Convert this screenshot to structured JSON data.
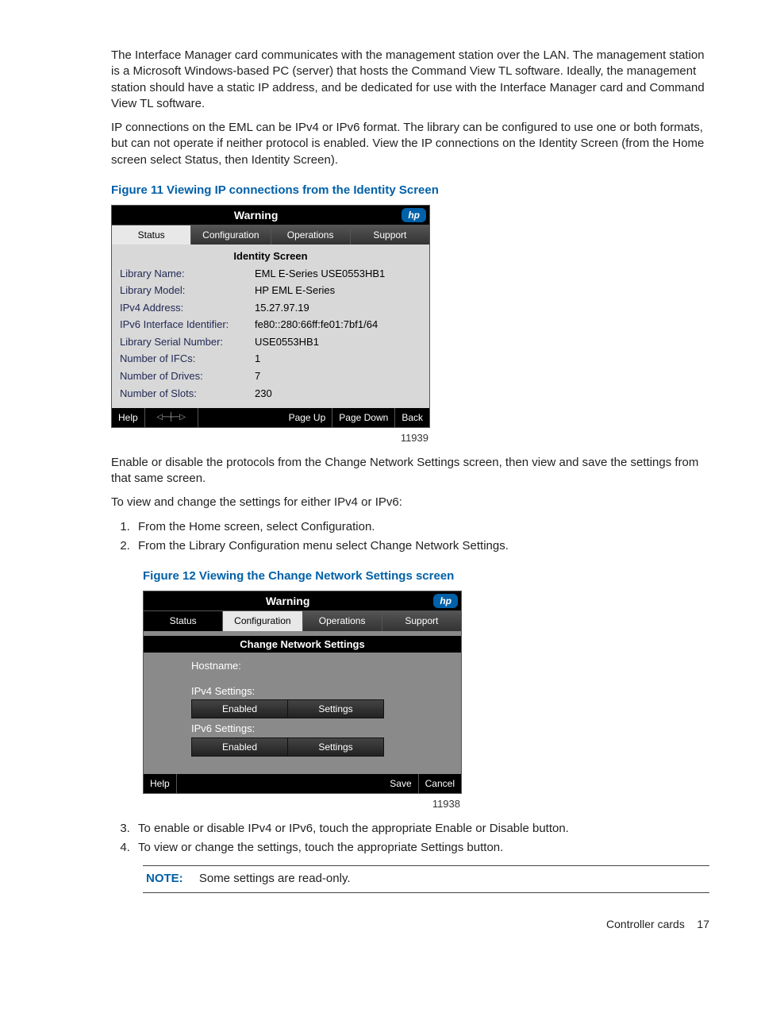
{
  "paragraphs": {
    "p1": "The Interface Manager card communicates with the management station over the LAN. The management station is a Microsoft Windows-based PC (server) that hosts the Command View TL software. Ideally, the management station should have a static IP address, and be dedicated for use with the Interface Manager card and Command View TL software.",
    "p2": "IP connections on the EML can be IPv4 or IPv6 format. The library can be configured to use one or both formats, but can not operate if neither protocol is enabled. View the IP connections on the Identity Screen (from the Home screen select Status, then Identity Screen).",
    "p3": "Enable or disable the protocols from the Change Network Settings screen, then view and save the settings from that same screen.",
    "p4": "To view and change the settings for either IPv4 or IPv6:"
  },
  "steps_top": [
    "From the Home screen, select Configuration.",
    "From the Library Configuration menu select Change Network Settings."
  ],
  "steps_bottom": [
    "To enable or disable IPv4 or IPv6, touch the appropriate Enable or Disable button.",
    "To view or change the settings, touch the appropriate Settings button."
  ],
  "figure11": {
    "caption": "Figure 11 Viewing IP connections from the Identity Screen",
    "header": "Warning",
    "tabs": [
      "Status",
      "Configuration",
      "Operations",
      "Support"
    ],
    "active_tab_index": 0,
    "screen_title": "Identity Screen",
    "rows": [
      {
        "label": "Library Name:",
        "value": "EML E-Series USE0553HB1"
      },
      {
        "label": "Library Model:",
        "value": "HP EML E-Series"
      },
      {
        "label": "IPv4 Address:",
        "value": "15.27.97.19"
      },
      {
        "label": "IPv6 Interface Identifier:",
        "value": "fe80::280:66ff:fe01:7bf1/64"
      },
      {
        "label": "Library Serial Number:",
        "value": "USE0553HB1"
      },
      {
        "label": "Number of IFCs:",
        "value": "1"
      },
      {
        "label": "Number of Drives:",
        "value": "7"
      },
      {
        "label": "Number of Slots:",
        "value": "230"
      }
    ],
    "footer": {
      "help": "Help",
      "page_up": "Page Up",
      "page_down": "Page Down",
      "back": "Back"
    },
    "fig_id": "11939"
  },
  "figure12": {
    "caption": "Figure 12 Viewing the Change Network Settings screen",
    "header": "Warning",
    "tabs": [
      "Status",
      "Configuration",
      "Operations",
      "Support"
    ],
    "active_tab_index": 1,
    "screen_title": "Change Network Settings",
    "hostname_label": "Hostname:",
    "ipv4_label": "IPv4 Settings:",
    "ipv6_label": "IPv6 Settings:",
    "enabled_label": "Enabled",
    "settings_label": "Settings",
    "footer": {
      "help": "Help",
      "save": "Save",
      "cancel": "Cancel"
    },
    "fig_id": "11938"
  },
  "note": {
    "label": "NOTE:",
    "text": "Some settings are read-only."
  },
  "page_footer": {
    "section": "Controller cards",
    "page": "17"
  }
}
